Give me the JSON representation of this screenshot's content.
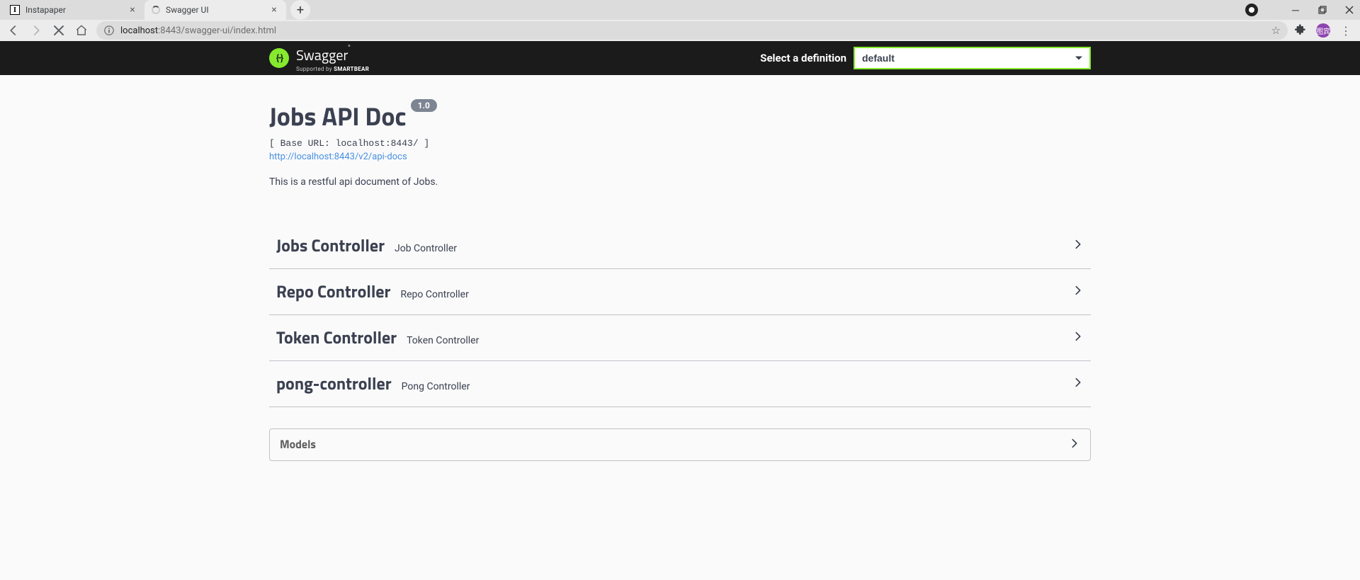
{
  "browser": {
    "tabs": [
      {
        "title": "Instapaper",
        "active": false,
        "faviconType": "insta"
      },
      {
        "title": "Swagger UI",
        "active": true,
        "faviconType": "loading"
      }
    ],
    "url": {
      "host": "localhost",
      "port": ":8443",
      "path": "/swagger-ui/index.html"
    },
    "avatarText": "图宾"
  },
  "topbar": {
    "brand": "Swagger",
    "subBrand": "Supported by SMARTBEAR",
    "selectLabel": "Select a definition",
    "selectedDefinition": "default"
  },
  "api": {
    "title": "Jobs API Doc",
    "version": "1.0",
    "baseUrlText": "[ Base URL: localhost:8443/ ]",
    "docsUrl": "http://localhost:8443/v2/api-docs",
    "description": "This is a restful api document of Jobs."
  },
  "tags": [
    {
      "name": "Jobs Controller",
      "description": "Job Controller"
    },
    {
      "name": "Repo Controller",
      "description": "Repo Controller"
    },
    {
      "name": "Token Controller",
      "description": "Token Controller"
    },
    {
      "name": "pong-controller",
      "description": "Pong Controller"
    }
  ],
  "models": {
    "title": "Models"
  }
}
